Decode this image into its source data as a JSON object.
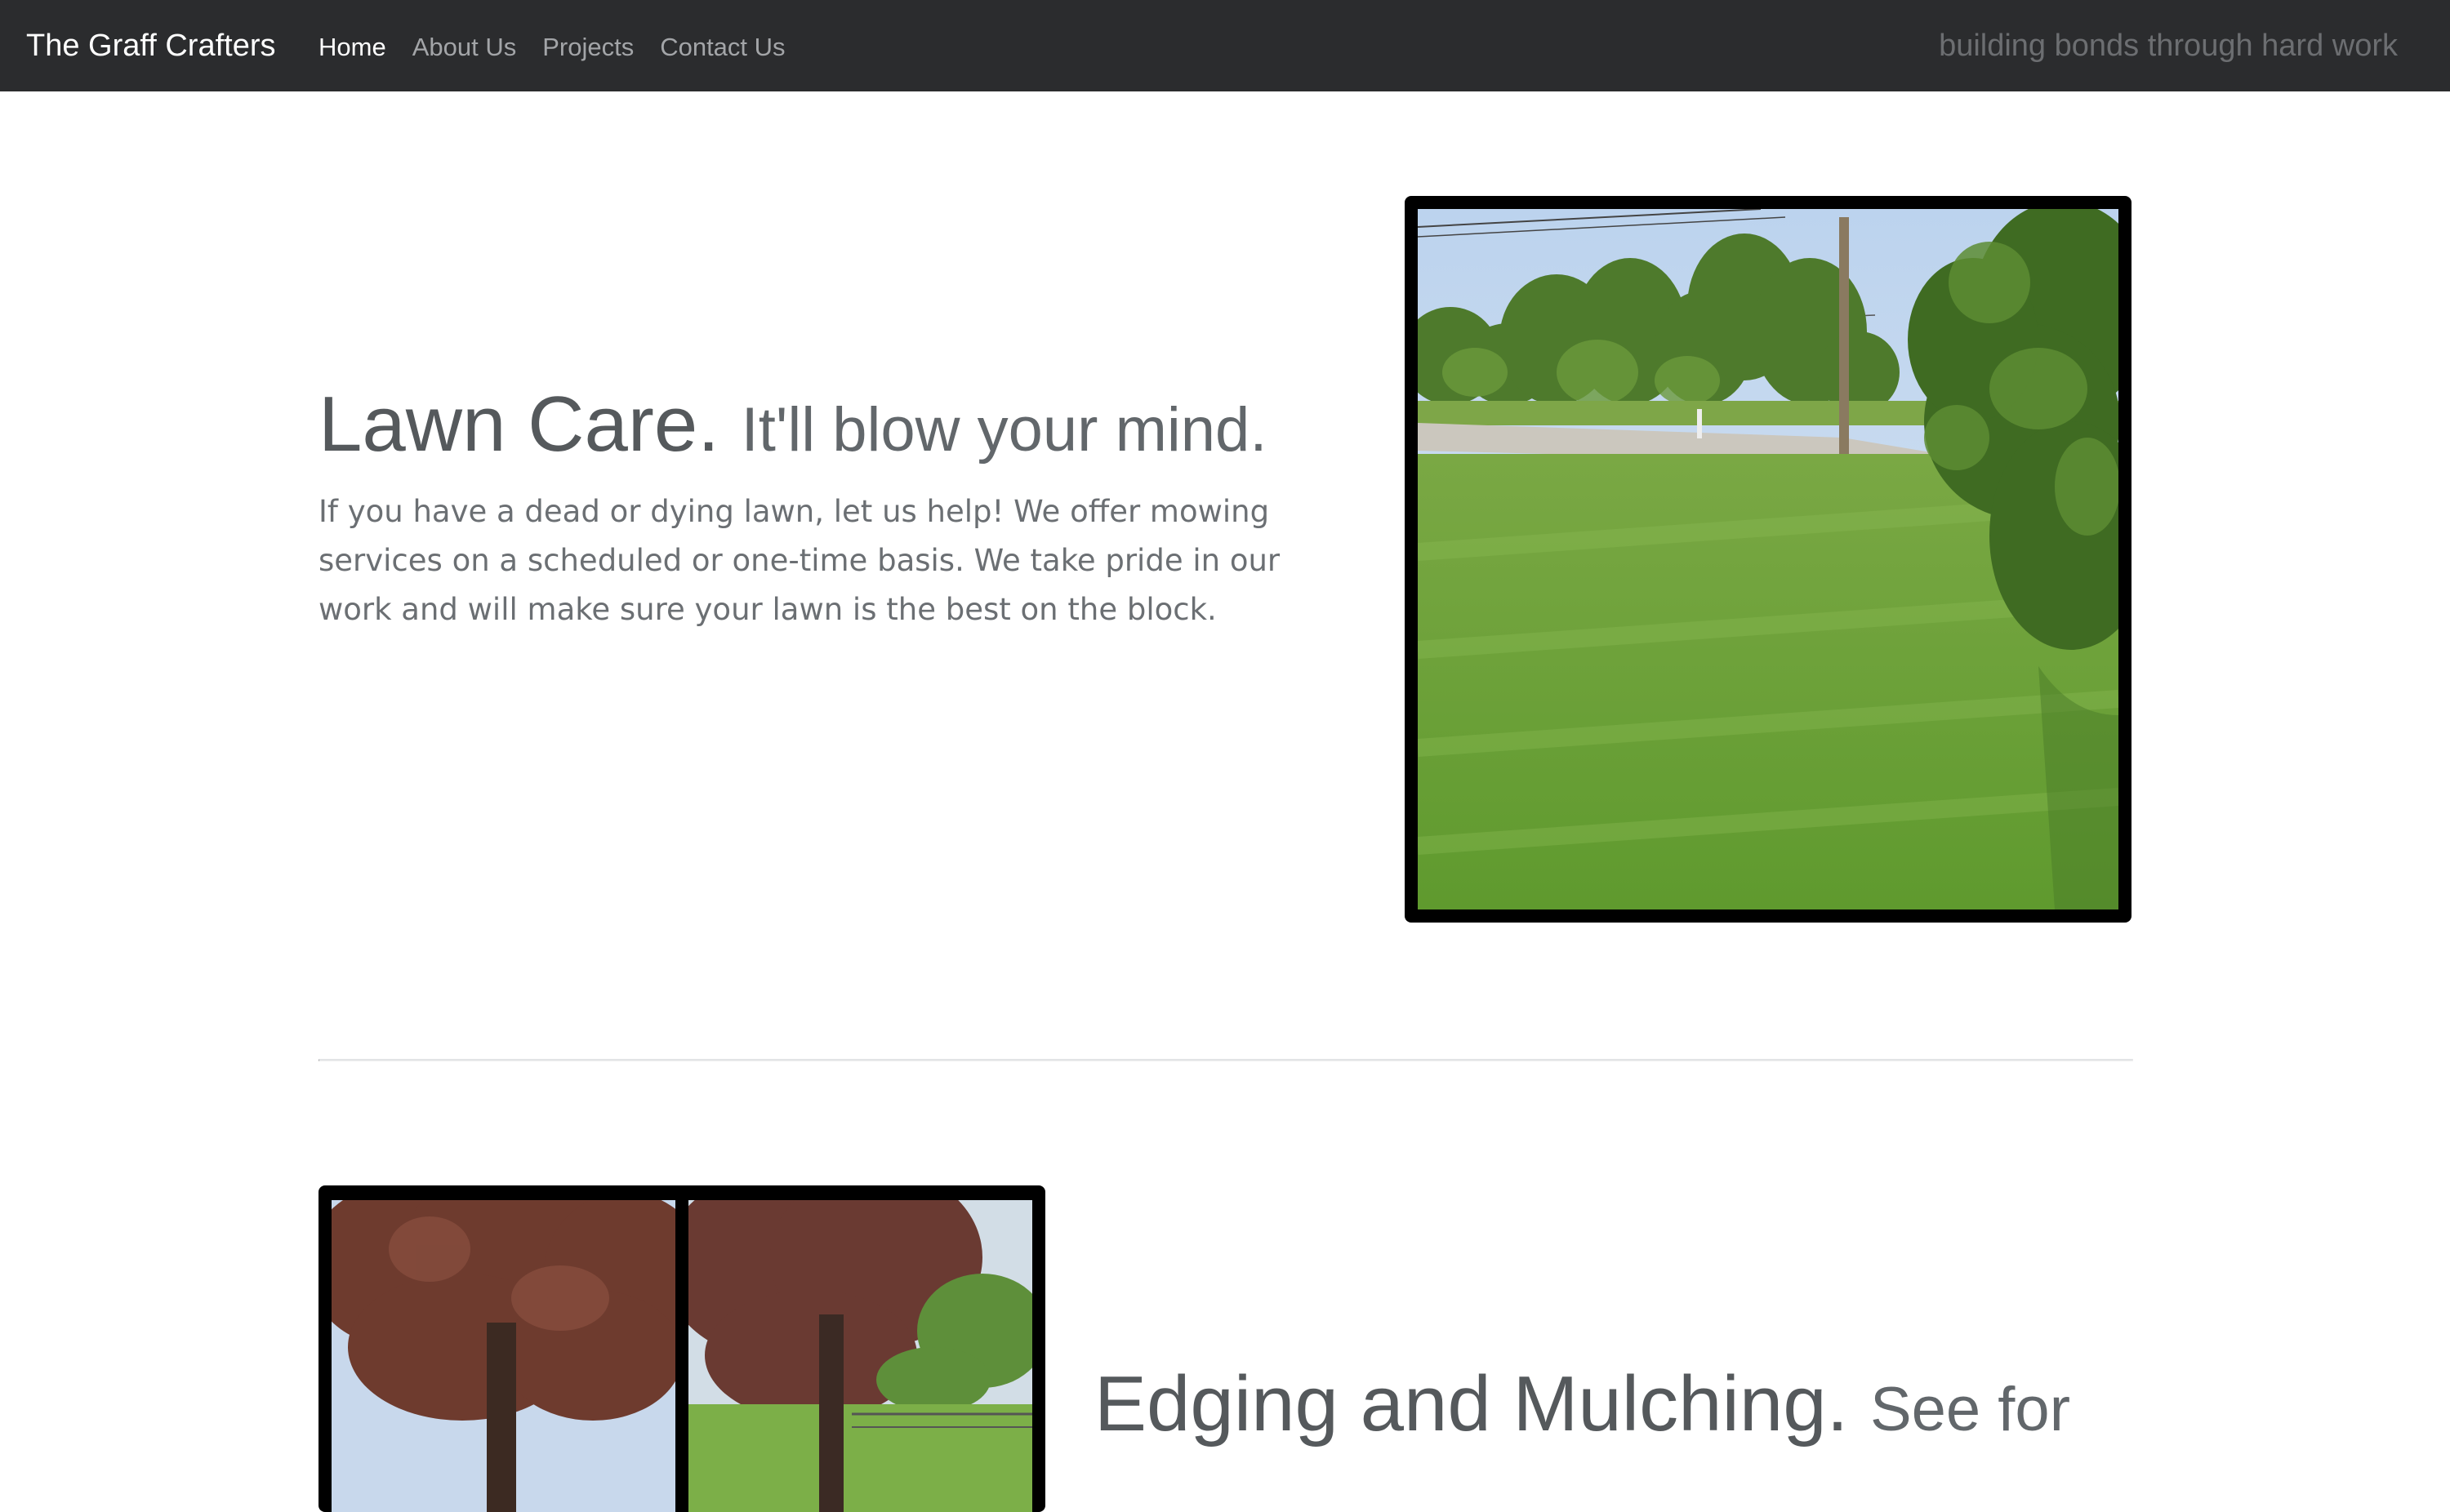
{
  "navbar": {
    "brand": "The Graff Crafters",
    "links": [
      {
        "label": "Home",
        "active": true
      },
      {
        "label": "About Us",
        "active": false
      },
      {
        "label": "Projects",
        "active": false
      },
      {
        "label": "Contact Us",
        "active": false
      }
    ],
    "tagline": "building bonds through hard work"
  },
  "features": [
    {
      "heading": "Lawn Care.",
      "subheading": "It'll blow your mind.",
      "lead": "If you have a dead or dying lawn, let us help! We offer mowing services on a scheduled or one-time basis. We take pride in our work and will make sure your lawn is the best on the block.",
      "image": "lawn-photo"
    },
    {
      "heading": "Edging and Mulching.",
      "subheading": "See for",
      "image": "tree-mulch-photos"
    }
  ],
  "colors": {
    "navbar_bg": "#2b2c2e",
    "heading": "#55595c",
    "text": "#6b6f73",
    "frame": "#000000"
  }
}
